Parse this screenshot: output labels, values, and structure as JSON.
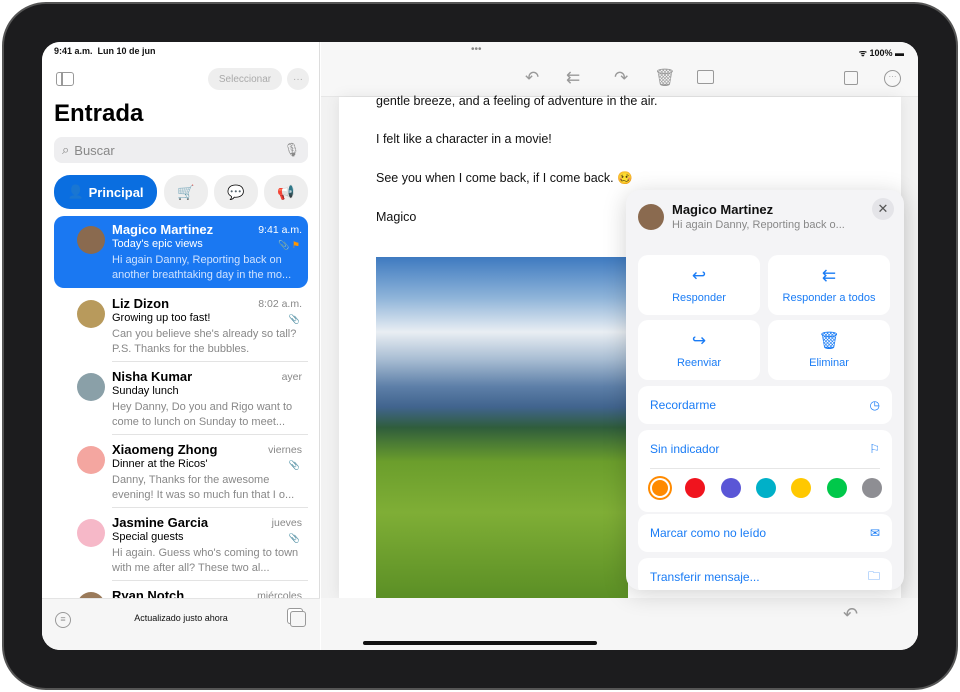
{
  "status": {
    "time": "9:41 a.m.",
    "date": "Lun 10 de jun",
    "battery": "100%"
  },
  "sidebar": {
    "select_label": "Seleccionar",
    "title": "Entrada",
    "search_placeholder": "Buscar",
    "categories": [
      {
        "label": "Principal",
        "icon": "person-icon"
      },
      {
        "icon": "cart-icon"
      },
      {
        "icon": "message-icon"
      },
      {
        "icon": "megaphone-icon"
      }
    ],
    "footer_status": "Actualizado justo ahora"
  },
  "emails": [
    {
      "sender": "Magico Martinez",
      "time": "9:41 a.m.",
      "subject": "Today's epic views",
      "preview": "Hi again Danny, Reporting back on another breathtaking day in the mo...",
      "avatar_color": "#8a6a4f"
    },
    {
      "sender": "Liz Dizon",
      "time": "8:02 a.m.",
      "subject": "Growing up too fast!",
      "preview": "Can you believe she's already so tall? P.S. Thanks for the bubbles.",
      "avatar_color": "#b89a5c"
    },
    {
      "sender": "Nisha Kumar",
      "time": "ayer",
      "subject": "Sunday lunch",
      "preview": "Hey Danny, Do you and Rigo want to come to lunch on Sunday to meet...",
      "avatar_color": "#8aa0a8"
    },
    {
      "sender": "Xiaomeng Zhong",
      "time": "viernes",
      "subject": "Dinner at the Ricos'",
      "preview": "Danny, Thanks for the awesome evening! It was so much fun that I o...",
      "avatar_color": "#f4a6a0"
    },
    {
      "sender": "Jasmine Garcia",
      "time": "jueves",
      "subject": "Special guests",
      "preview": "Hi again. Guess who's coming to town with me after all? These two al...",
      "avatar_color": "#f6b8c8"
    },
    {
      "sender": "Ryan Notch",
      "time": "miércoles",
      "subject": "",
      "preview": "",
      "avatar_color": "#9a7a5a"
    }
  ],
  "message": {
    "lines": [
      "gentle breeze, and a feeling of adventure in the air.",
      "I felt like a character in a movie!",
      "See you when I come back, if I come back. 🥴",
      "Magico"
    ]
  },
  "popover": {
    "sender": "Magico Martinez",
    "preview": "Hi again Danny, Reporting back o...",
    "actions": [
      "Responder",
      "Responder a todos",
      "Reenviar",
      "Eliminar"
    ],
    "remind": "Recordarme",
    "flag": "Sin indicador",
    "flag_colors": [
      "#ff8a00",
      "#f0141e",
      "#5a56d6",
      "#00b0c8",
      "#ffc800",
      "#00c84a",
      "#8e8e93"
    ],
    "mark_unread": "Marcar como no leído",
    "move": "Transferir mensaje..."
  },
  "accent": "#1a78f2"
}
